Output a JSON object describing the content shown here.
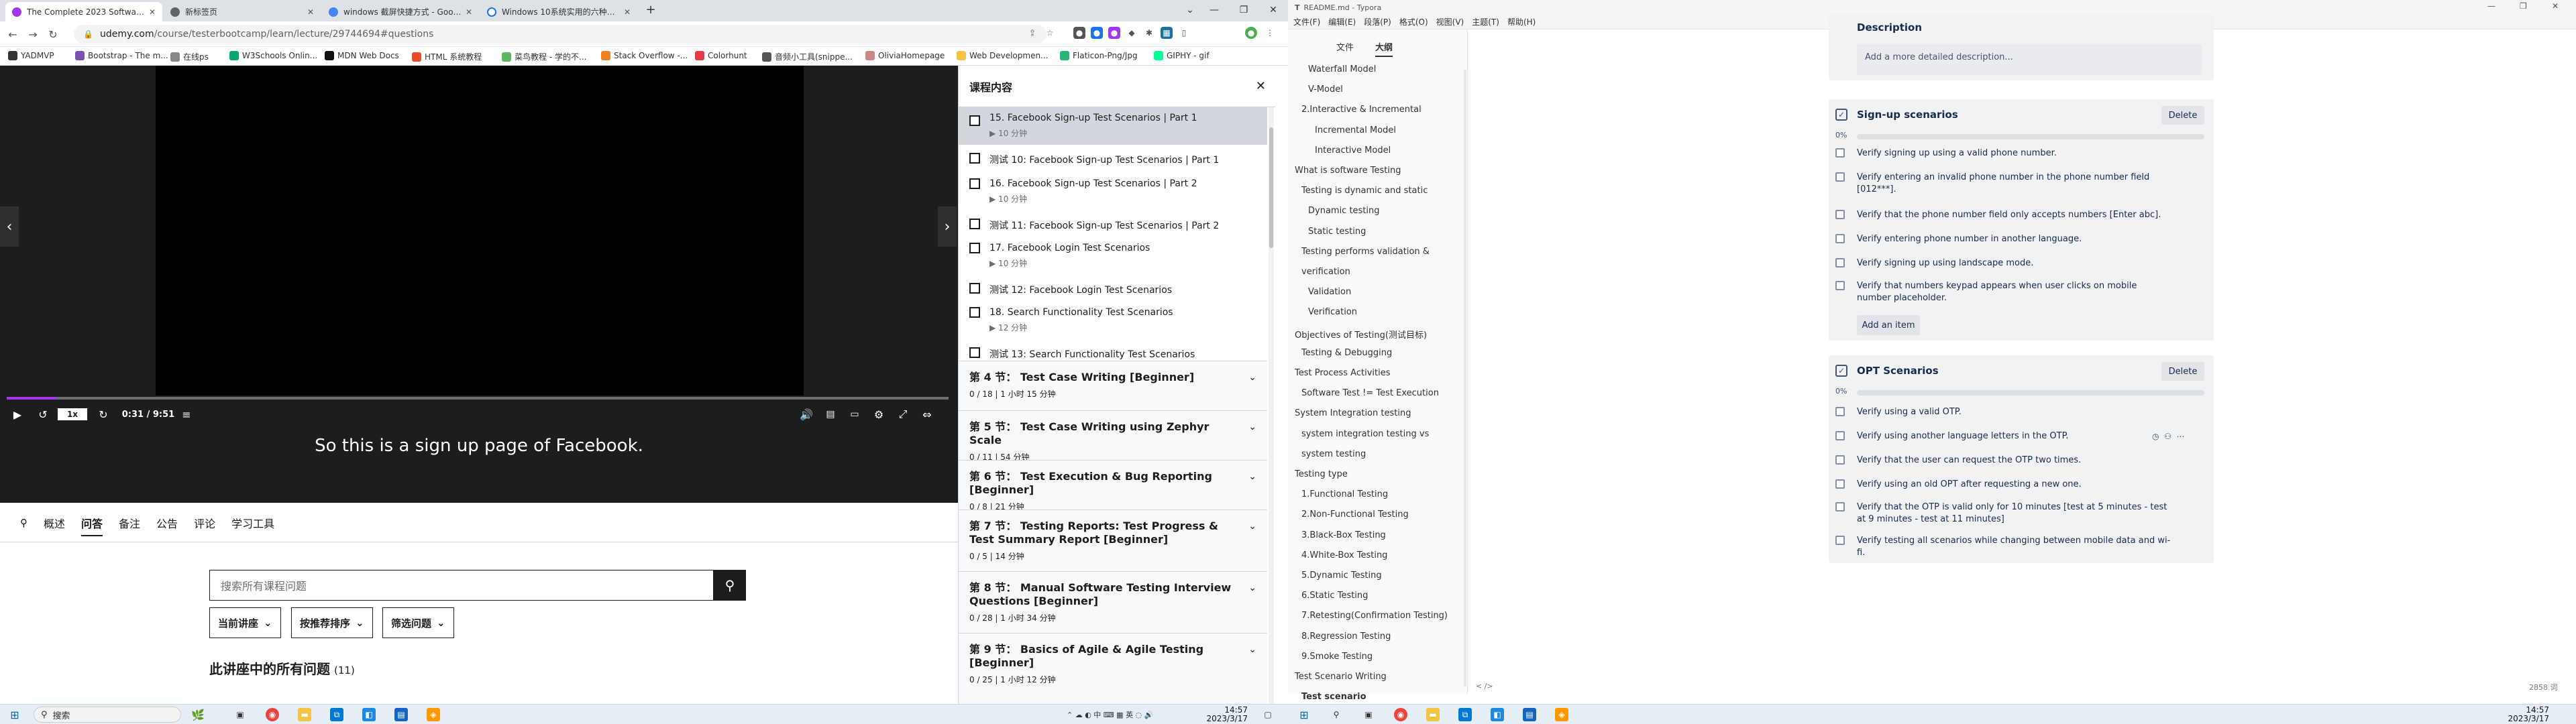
{
  "browser": {
    "tabs": [
      {
        "title": "The Complete 2023 Software Testing",
        "color": "#a435f0"
      },
      {
        "title": "新标签页",
        "color": "#5f6368"
      },
      {
        "title": "windows 截屏快捷方式 - Google",
        "color": "#4285f4"
      },
      {
        "title": "Windows 10系统实用的六种截屏",
        "color": "#1a73e8"
      }
    ],
    "new_tab": "+",
    "url_host": "udemy.com",
    "url_path": "/course/testerbootcamp/learn/lecture/29744694#questions",
    "bookmarks": [
      "YADMVP",
      "Bootstrap - The m...",
      "在线ps",
      "W3Schools Onlin...",
      "MDN Web Docs",
      "HTML 系统教程",
      "菜鸟教程 - 学的不...",
      "Stack Overflow -...",
      "Colorhunt",
      "音频小工具(snippe...",
      "OliviaHomepage",
      "Web Developmen...",
      "Flaticon-Png/Jpg",
      "GIPHY - gif"
    ]
  },
  "player": {
    "speed": "1x",
    "time": "0:31 / 9:51",
    "progress": 0.053,
    "caption": "So this is a sign up page of Facebook."
  },
  "below": {
    "tabs": [
      "概述",
      "问答",
      "备注",
      "公告",
      "评论",
      "学习工具"
    ],
    "active_tab": "问答",
    "search_placeholder": "搜索所有课程问题",
    "filters": [
      "当前讲座",
      "按推荐排序",
      "筛选问题"
    ],
    "all_questions": "此讲座中的所有问题",
    "count": "(11)"
  },
  "course": {
    "header": "课程内容",
    "lectures": [
      {
        "title": "15. Facebook Sign-up Test Scenarios | Part 1",
        "duration": "10 分钟",
        "current": true
      },
      {
        "title": "测试 10:    Facebook Sign-up Test Scenarios | Part 1",
        "duration": ""
      },
      {
        "title": "16. Facebook Sign-up Test Scenarios | Part 2",
        "duration": "10 分钟"
      },
      {
        "title": "测试 11:    Facebook Sign-up Test Scenarios | Part 2",
        "duration": ""
      },
      {
        "title": "17. Facebook Login Test Scenarios",
        "duration": "10 分钟"
      },
      {
        "title": "测试 12:    Facebook Login Test Scenarios",
        "duration": ""
      },
      {
        "title": "18. Search Functionality Test Scenarios",
        "duration": "12 分钟"
      },
      {
        "title": "测试 13:    Search Functionality Test Scenarios",
        "duration": ""
      }
    ],
    "sections": [
      {
        "title": "第 4 节：  Test Case Writing [Beginner]",
        "meta": "0 / 18 | 1 小时 15 分钟"
      },
      {
        "title": "第 5 节：  Test Case Writing using Zephyr Scale",
        "meta": "0 / 11 | 54 分钟"
      },
      {
        "title": "第 6 节：  Test Execution & Bug Reporting [Beginner]",
        "meta": "0 / 8 | 21 分钟"
      },
      {
        "title": "第 7 节：  Testing Reports: Test Progress & Test Summary Report [Beginner]",
        "meta": "0 / 5 | 14 分钟"
      },
      {
        "title": "第 8 节：  Manual Software Testing Interview Questions [Beginner]",
        "meta": "0 / 28 | 1 小时 34 分钟"
      },
      {
        "title": "第 9 节：  Basics of Agile & Agile Testing [Beginner]",
        "meta": "0 / 25 | 1 小时 12 分钟"
      }
    ]
  },
  "taskbar": {
    "search": "搜索",
    "time": "14:57",
    "date": "2023/3/17"
  },
  "typora": {
    "title": "README.md - Typora",
    "menu": [
      "文件(F)",
      "编辑(E)",
      "段落(P)",
      "格式(O)",
      "视图(V)",
      "主题(T)",
      "帮助(H)"
    ],
    "side_tabs": [
      "文件",
      "大纲"
    ],
    "outline": [
      {
        "text": "Waterfall Model",
        "lvl": 3
      },
      {
        "text": "V-Model",
        "lvl": 3
      },
      {
        "text": "2.Interactive & Incremental",
        "lvl": 2
      },
      {
        "text": "Incremental Model",
        "lvl": 4
      },
      {
        "text": "Interactive Model",
        "lvl": 4
      },
      {
        "text": "What is software Testing",
        "lvl": 1
      },
      {
        "text": "Testing is dynamic and static",
        "lvl": 2
      },
      {
        "text": "Dynamic testing",
        "lvl": 3
      },
      {
        "text": "Static testing",
        "lvl": 3
      },
      {
        "text": "Testing performs validation &",
        "lvl": 2
      },
      {
        "text": "verification",
        "lvl": 2
      },
      {
        "text": "Validation",
        "lvl": 3
      },
      {
        "text": "Verification",
        "lvl": 3
      },
      {
        "text": "Objectives of Testing(测试目标)",
        "lvl": 1
      },
      {
        "text": "Testing & Debugging",
        "lvl": 2
      },
      {
        "text": "Test Process Activities",
        "lvl": 1
      },
      {
        "text": "Software Test != Test Execution",
        "lvl": 2
      },
      {
        "text": "System Integration testing",
        "lvl": 1
      },
      {
        "text": "system integration testing vs",
        "lvl": 2
      },
      {
        "text": "system testing",
        "lvl": 2
      },
      {
        "text": "Testing type",
        "lvl": 1
      },
      {
        "text": "1.Functional Testing",
        "lvl": 2
      },
      {
        "text": "2.Non-Functional Testing",
        "lvl": 2
      },
      {
        "text": "3.Black-Box Testing",
        "lvl": 2
      },
      {
        "text": "4.White-Box Testing",
        "lvl": 2
      },
      {
        "text": "5.Dynamic Testing",
        "lvl": 2
      },
      {
        "text": "6.Static Testing",
        "lvl": 2
      },
      {
        "text": "7.Retesting(Confirmation Testing)",
        "lvl": 2
      },
      {
        "text": "8.Regression Testing",
        "lvl": 2
      },
      {
        "text": "9.Smoke Testing",
        "lvl": 2
      },
      {
        "text": "Test Scenario Writing",
        "lvl": 1
      },
      {
        "text": "Test scenario",
        "lvl": 2
      }
    ],
    "description_label": "Description",
    "description_placeholder": "Add a more detailed description...",
    "cards": [
      {
        "title": "Sign-up scenarios",
        "delete": "Delete",
        "percent": "0%",
        "items": [
          "Verify signing up using a valid phone number.",
          "Verify entering an invalid phone number in the phone number field [012***].",
          "Verify that the phone number field only accepts numbers [Enter abc].",
          "Verify entering phone number in another language.",
          "Verify signing up using landscape mode.",
          "Verify that numbers keypad appears when user clicks on mobile number placeholder."
        ],
        "add": "Add an item"
      },
      {
        "title": "OPT Scenarios",
        "delete": "Delete",
        "percent": "0%",
        "items": [
          "Verify using a valid OTP.",
          "Verify using another language letters in the OTP.",
          "Verify that the user can request the OTP two times.",
          "Verify using an old OPT after requesting a new one.",
          "Verify that the OTP is valid only for 10 minutes [test at 5 minutes - test at 9 minutes - test at 11 minutes]",
          "Verify testing all scenarios while changing between mobile data and wi-fi."
        ]
      }
    ],
    "status_left": "< />",
    "word_count": "2858 词"
  }
}
